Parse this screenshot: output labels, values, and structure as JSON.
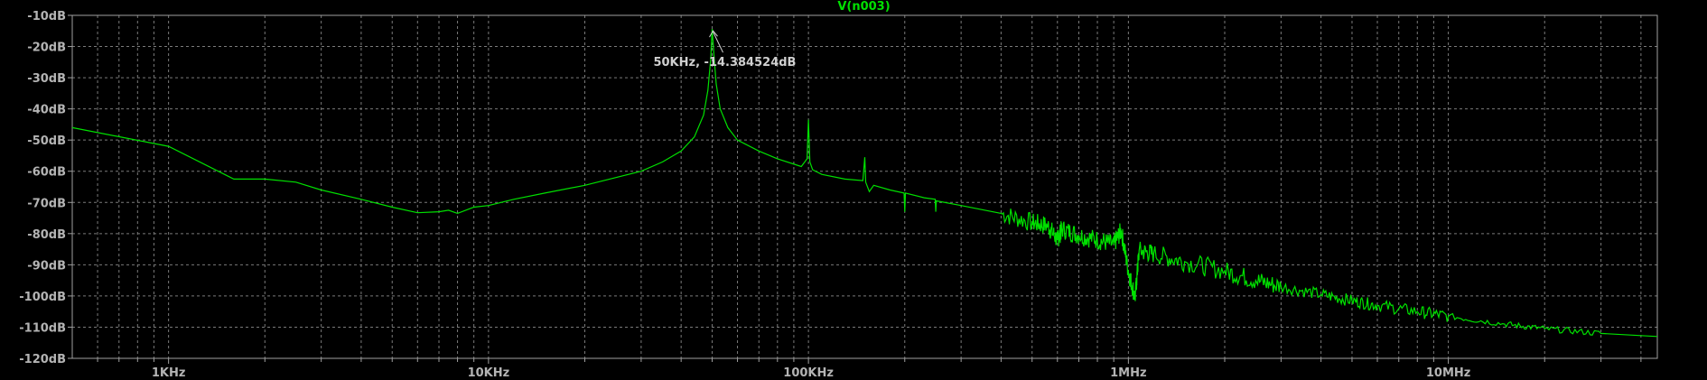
{
  "colors": {
    "background": "#000000",
    "plot_border": "#a0a0a0",
    "grid": "#7a7a7a",
    "trace": "#00e000",
    "title": "#00e000",
    "tick_text": "#b4b4b4",
    "annotation_text": "#d0d0d0"
  },
  "chart_data": {
    "type": "line",
    "title": "V(n003)",
    "xlabel": "",
    "ylabel": "",
    "x_scale": "log",
    "xlim": [
      500,
      45000000
    ],
    "ylim": [
      -120,
      -10
    ],
    "grid": true,
    "grid_style": "dashed",
    "x_ticks": [
      {
        "value": 1000,
        "label": "1KHz"
      },
      {
        "value": 10000,
        "label": "10KHz"
      },
      {
        "value": 100000,
        "label": "100KHz"
      },
      {
        "value": 1000000,
        "label": "1MHz"
      },
      {
        "value": 10000000,
        "label": "10MHz"
      }
    ],
    "y_ticks": [
      {
        "value": -10,
        "label": "-10dB"
      },
      {
        "value": -20,
        "label": "-20dB"
      },
      {
        "value": -30,
        "label": "-30dB"
      },
      {
        "value": -40,
        "label": "-40dB"
      },
      {
        "value": -50,
        "label": "-50dB"
      },
      {
        "value": -60,
        "label": "-60dB"
      },
      {
        "value": -70,
        "label": "-70dB"
      },
      {
        "value": -80,
        "label": "-80dB"
      },
      {
        "value": -90,
        "label": "-90dB"
      },
      {
        "value": -100,
        "label": "-100dB"
      },
      {
        "value": -110,
        "label": "-110dB"
      },
      {
        "value": -120,
        "label": "-120dB"
      }
    ],
    "series": [
      {
        "values_x_y": [
          [
            500,
            -46
          ],
          [
            1000,
            -52
          ],
          [
            1600,
            -62.5
          ],
          [
            2000,
            -62.5
          ],
          [
            2500,
            -63.5
          ],
          [
            3000,
            -66
          ],
          [
            4000,
            -69
          ],
          [
            5000,
            -71.5
          ],
          [
            6000,
            -73.3
          ],
          [
            7000,
            -73
          ],
          [
            7500,
            -72.5
          ],
          [
            8000,
            -73.5
          ],
          [
            9000,
            -71.5
          ],
          [
            10000,
            -71
          ],
          [
            12000,
            -69
          ],
          [
            15000,
            -67
          ],
          [
            20000,
            -64.5
          ],
          [
            30000,
            -60
          ],
          [
            35000,
            -57
          ],
          [
            40000,
            -53.5
          ],
          [
            44000,
            -49
          ],
          [
            47000,
            -42
          ],
          [
            48500,
            -34
          ],
          [
            49500,
            -24
          ],
          [
            50000,
            -14.4
          ],
          [
            50600,
            -22
          ],
          [
            51500,
            -32
          ],
          [
            53000,
            -40
          ],
          [
            56000,
            -46
          ],
          [
            60000,
            -50
          ],
          [
            70000,
            -53.5
          ],
          [
            80000,
            -56
          ],
          [
            95000,
            -58.5
          ],
          [
            99000,
            -56
          ],
          [
            100000,
            -43.5
          ],
          [
            101000,
            -57
          ],
          [
            103000,
            -59.5
          ],
          [
            110000,
            -61
          ],
          [
            130000,
            -62.5
          ],
          [
            148000,
            -63
          ],
          [
            150000,
            -55.5
          ],
          [
            151000,
            -63.5
          ],
          [
            155000,
            -66.5
          ],
          [
            160000,
            -64.5
          ],
          [
            180000,
            -66
          ],
          [
            199000,
            -67
          ],
          [
            200000,
            -73
          ],
          [
            201000,
            -67
          ],
          [
            230000,
            -68.5
          ],
          [
            249000,
            -69
          ],
          [
            250000,
            -73
          ],
          [
            251000,
            -69.5
          ],
          [
            300000,
            -71
          ],
          [
            400000,
            -73.5
          ],
          [
            500000,
            -76.5
          ],
          [
            560000,
            -77.5
          ],
          [
            600000,
            -82
          ],
          [
            620000,
            -78.5
          ],
          [
            700000,
            -80.5
          ],
          [
            800000,
            -82
          ],
          [
            900000,
            -83.5
          ],
          [
            950000,
            -79
          ],
          [
            1000000,
            -92
          ],
          [
            1050000,
            -100.5
          ],
          [
            1080000,
            -85.5
          ],
          [
            1200000,
            -86.5
          ],
          [
            1500000,
            -89
          ],
          [
            2000000,
            -92
          ],
          [
            2500000,
            -95
          ],
          [
            3000000,
            -97
          ],
          [
            4000000,
            -99.5
          ],
          [
            5000000,
            -101.5
          ],
          [
            6000000,
            -103
          ],
          [
            8000000,
            -105
          ],
          [
            10000000,
            -106.5
          ],
          [
            15000000,
            -109
          ],
          [
            20000000,
            -110.5
          ],
          [
            30000000,
            -112
          ],
          [
            45000000,
            -113
          ]
        ]
      }
    ],
    "annotations": [
      {
        "text": "50KHz, -14.384524dB",
        "x": 50000,
        "y": -14.384524
      }
    ]
  }
}
